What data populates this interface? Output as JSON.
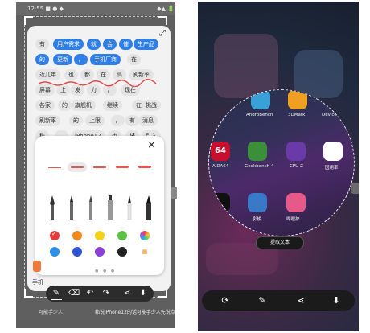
{
  "left": {
    "status_left": "12:55 ■ ● ◆",
    "status_right": "◆▲ 🔋",
    "expand_icon": "expand-icon",
    "tokens_row1": [
      "有",
      "用户需求",
      "就",
      "会",
      "催",
      "生产品"
    ],
    "tokens_row2": [
      "的",
      "更新",
      "，",
      "手机厂商",
      "在"
    ],
    "tokens_row3": [
      "近几年",
      "也",
      "都",
      "在",
      "高",
      "刷新率"
    ],
    "tokens_row4": [
      "屏幕",
      "上",
      "发",
      "力",
      "，",
      "现在"
    ],
    "tokens_row5": [
      "各家",
      "的",
      "旗舰机",
      "继续",
      "在",
      "挑战"
    ],
    "tokens_row6": [
      "刷新率",
      "的",
      "上限",
      "，",
      "有",
      "消息"
    ],
    "tokens_row7": [
      "称",
      "，",
      "iPhone12",
      "也",
      "将",
      "引入"
    ],
    "close_symbol": "×",
    "page_dots": "● ● ●",
    "under_text": "手机",
    "caption1": "可能手少人",
    "caption2": "都说iPhone12的话可能手少人先说点的话",
    "swatch_colors": [
      "#e43b3b",
      "#f08a1e",
      "#f4d21c",
      "#5cc244",
      "#2f8ee8",
      "#2f55d6",
      "#8a3fd6",
      "#222222"
    ]
  },
  "right": {
    "apps_row1": [
      {
        "label": "AndroBench",
        "color": "#3aa0d8"
      },
      {
        "label": "3DMark",
        "color": "#f0a020"
      },
      {
        "label": "Device Info",
        "color": "#2a4a9a"
      }
    ],
    "apps_row2": [
      {
        "label": "AIDA64",
        "color": "#c8102e",
        "text": "64"
      },
      {
        "label": "Geekbench 4",
        "color": "#3b8f3b"
      },
      {
        "label": "CPU-Z",
        "color": "#6a3aa8"
      },
      {
        "label": "因用率",
        "color": "#ffffff"
      }
    ],
    "apps_row3": [
      {
        "label": "",
        "color": "#111111"
      },
      {
        "label": "影梭",
        "color": "#3a78c8"
      },
      {
        "label": "哔哩护",
        "color": "#e65a8a"
      }
    ],
    "extract_label": "提取文本"
  }
}
